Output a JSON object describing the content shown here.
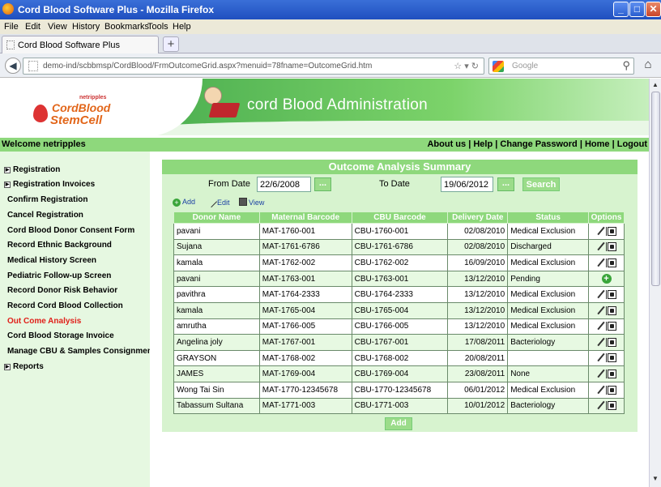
{
  "window": {
    "title": "Cord Blood Software Plus - Mozilla Firefox",
    "min": "_",
    "max": "□",
    "close": "✕"
  },
  "menu": [
    "File",
    "Edit",
    "View",
    "History",
    "Bookmarks",
    "Tools",
    "Help"
  ],
  "tab": {
    "label": "Cord Blood Software Plus",
    "newtab": "+"
  },
  "nav": {
    "url": "demo-ind/scbbmsp/CordBlood/FrmOutcomeGrid.aspx?menuid=78fname=OutcomeGrid.htm",
    "search_placeholder": "Google"
  },
  "header": {
    "logo_small": "netripples",
    "logo_line1": "CordBlood",
    "logo_line2": "StemCell",
    "title": "cord Blood Administration"
  },
  "welcome": {
    "text": "Welcome netripples",
    "links": [
      "About us",
      "Help",
      "Change Password",
      "Home",
      "Logout"
    ]
  },
  "sidebar": {
    "items": [
      {
        "label": "Registration",
        "arrow": "▶"
      },
      {
        "label": "Registration Invoices",
        "arrow": "▶"
      },
      {
        "label": "Confirm Registration"
      },
      {
        "label": "Cancel Registration"
      },
      {
        "label": "Cord Blood Donor Consent Form"
      },
      {
        "label": "Record Ethnic Background"
      },
      {
        "label": "Medical History Screen"
      },
      {
        "label": "Pediatric Follow-up Screen"
      },
      {
        "label": "Record Donor Risk Behavior"
      },
      {
        "label": "Record Cord Blood Collection"
      },
      {
        "label": "Out Come Analysis"
      },
      {
        "label": "Cord Blood Storage Invoice"
      },
      {
        "label": "Manage CBU & Samples Consignment"
      },
      {
        "label": "Reports",
        "arrow": "▶"
      }
    ],
    "active_color": "#e0201a"
  },
  "panel": {
    "title": "Outcome Analysis Summary",
    "from_label": "From Date",
    "from_value": "22/6/2008",
    "to_label": "To Date",
    "to_value": "19/06/2012",
    "picker": "...",
    "search": "Search",
    "add_link": "Add",
    "edit_link": "Edit",
    "view_link": "View",
    "add_button": "Add"
  },
  "grid": {
    "headers": [
      "Donor Name",
      "Maternal Barcode",
      "CBU Barcode",
      "Delivery Date",
      "Status",
      "Options"
    ],
    "rows": [
      [
        "pavani",
        "MAT-1760-001",
        "CBU-1760-001",
        "02/08/2010",
        "Medical Exclusion"
      ],
      [
        "Sujana",
        "MAT-1761-6786",
        "CBU-1761-6786",
        "02/08/2010",
        "Discharged"
      ],
      [
        "kamala",
        "MAT-1762-002",
        "CBU-1762-002",
        "16/09/2010",
        "Medical Exclusion"
      ],
      [
        "pavani",
        "MAT-1763-001",
        "CBU-1763-001",
        "13/12/2010",
        "Pending"
      ],
      [
        "pavithra",
        "MAT-1764-2333",
        "CBU-1764-2333",
        "13/12/2010",
        "Medical Exclusion"
      ],
      [
        "kamala",
        "MAT-1765-004",
        "CBU-1765-004",
        "13/12/2010",
        "Medical Exclusion"
      ],
      [
        "amrutha",
        "MAT-1766-005",
        "CBU-1766-005",
        "13/12/2010",
        "Medical Exclusion"
      ],
      [
        "Angelina joly",
        "MAT-1767-001",
        "CBU-1767-001",
        "17/08/2011",
        "Bacteriology"
      ],
      [
        "GRAYSON",
        "MAT-1768-002",
        "CBU-1768-002",
        "20/08/2011",
        ""
      ],
      [
        "JAMES",
        "MAT-1769-004",
        "CBU-1769-004",
        "23/08/2011",
        "None"
      ],
      [
        "Wong Tai Sin",
        "MAT-1770-12345678",
        "CBU-1770-12345678",
        "06/01/2012",
        "Medical Exclusion"
      ],
      [
        "Tabassum Sultana",
        "MAT-1771-003",
        "CBU-1771-003",
        "10/01/2012",
        "Bacteriology"
      ]
    ],
    "pending_row_index": 3
  },
  "colors": {
    "green_header": "#8ed87c",
    "panel_bg": "#d7f3cf",
    "sidebar_bg": "#e6f8e1"
  }
}
